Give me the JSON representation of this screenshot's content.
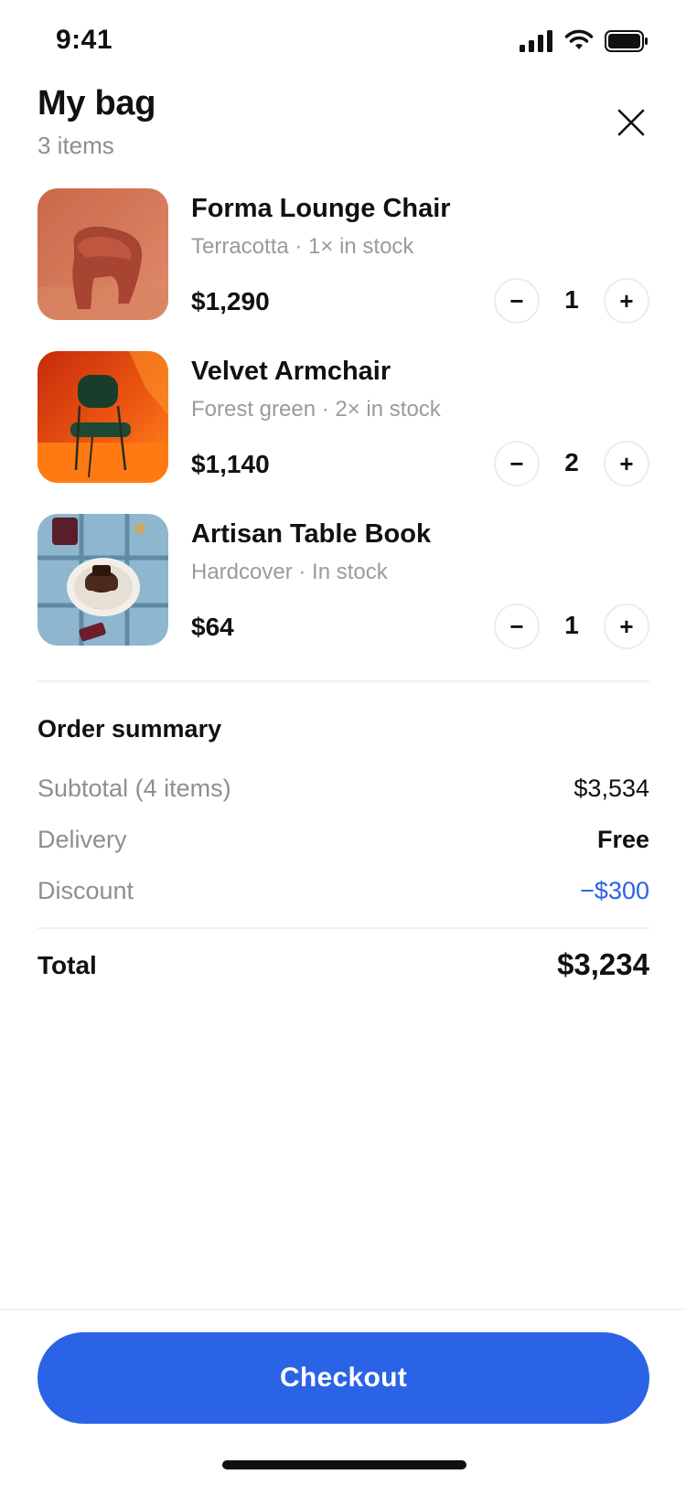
{
  "status_bar": {
    "time": "9:41"
  },
  "header": {
    "title": "My bag",
    "subtitle": "3 items"
  },
  "cart": {
    "items": [
      {
        "title": "Forma Lounge Chair",
        "meta": "Terracotta · 1× in stock",
        "price": "$1,290",
        "quantity": "1",
        "image": "terracotta-lounge-chair-photo"
      },
      {
        "title": "Velvet Armchair",
        "meta": "Forest green · 2× in stock",
        "price": "$1,140",
        "quantity": "2",
        "image": "green-chair-orange-room-photo"
      },
      {
        "title": "Artisan Table Book",
        "meta": "Hardcover · In stock",
        "price": "$64",
        "quantity": "1",
        "image": "dessert-plate-blue-tray-photo"
      }
    ],
    "stepper": {
      "minus": "−",
      "plus": "+"
    }
  },
  "summary": {
    "title": "Order summary",
    "subtotal_label": "Subtotal (4 items)",
    "subtotal_value": "$3,534",
    "delivery_label": "Delivery",
    "delivery_value": "Free",
    "discount_label": "Discount",
    "discount_value": "−$300",
    "total_label": "Total",
    "total_value": "$3,234"
  },
  "checkout": {
    "label": "Checkout"
  },
  "colors": {
    "accent": "#2a63e6",
    "muted_text": "#8e8e93",
    "divider": "#f0f0f2"
  }
}
